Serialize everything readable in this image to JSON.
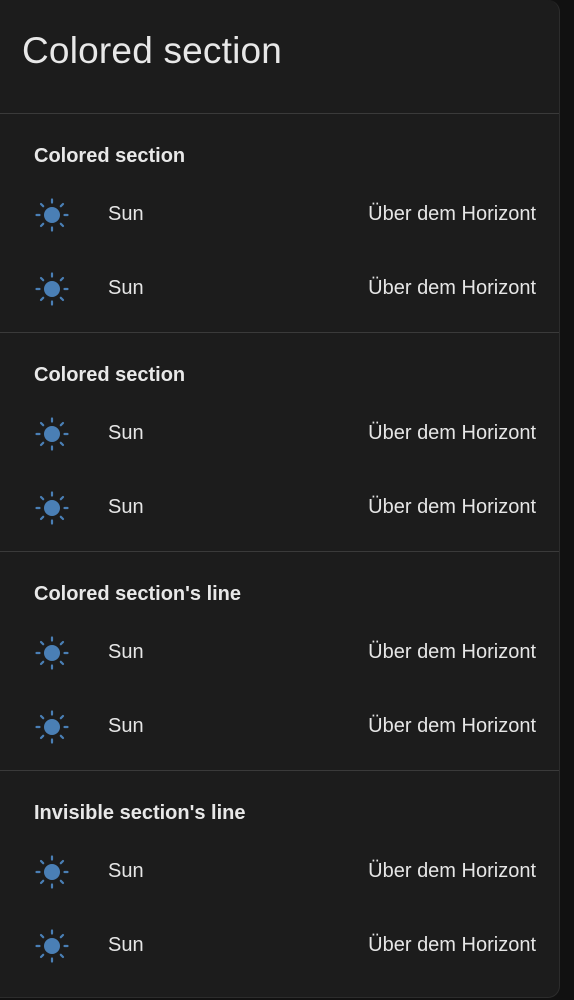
{
  "card": {
    "title": "Colored section"
  },
  "colors": {
    "background": "#1c1c1c",
    "icon": "#4a7fb5",
    "divider": "#3a3a3a"
  },
  "sections": [
    {
      "title": "Colored section",
      "rows": [
        {
          "icon": "sun-icon",
          "name": "Sun",
          "state": "Über dem Horizont"
        },
        {
          "icon": "sun-icon",
          "name": "Sun",
          "state": "Über dem Horizont"
        }
      ]
    },
    {
      "title": "Colored section",
      "rows": [
        {
          "icon": "sun-icon",
          "name": "Sun",
          "state": "Über dem Horizont"
        },
        {
          "icon": "sun-icon",
          "name": "Sun",
          "state": "Über dem Horizont"
        }
      ]
    },
    {
      "title": "Colored section's line",
      "rows": [
        {
          "icon": "sun-icon",
          "name": "Sun",
          "state": "Über dem Horizont"
        },
        {
          "icon": "sun-icon",
          "name": "Sun",
          "state": "Über dem Horizont"
        }
      ]
    },
    {
      "title": "Invisible section's line",
      "rows": [
        {
          "icon": "sun-icon",
          "name": "Sun",
          "state": "Über dem Horizont"
        },
        {
          "icon": "sun-icon",
          "name": "Sun",
          "state": "Über dem Horizont"
        }
      ]
    }
  ]
}
